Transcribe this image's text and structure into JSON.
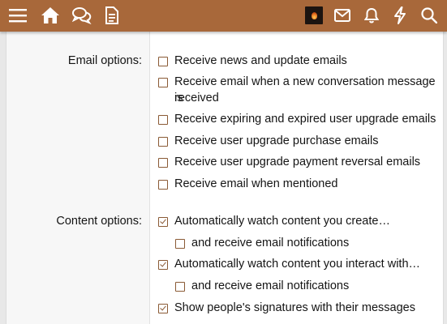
{
  "topbar": {
    "icons": [
      "menu-icon",
      "home-icon",
      "conversations-icon",
      "document-icon",
      "mail-icon",
      "bell-icon",
      "lightning-icon",
      "search-icon"
    ],
    "colors": {
      "bar": "#a8683a",
      "icon": "#ffffff"
    }
  },
  "email_options": {
    "label": "Email options:",
    "items": [
      {
        "text": "Receive news and update emails",
        "checked": false
      },
      {
        "text": "Receive email when a new conversation message is",
        "text2": "received",
        "checked": false
      },
      {
        "text": "Receive expiring and expired user upgrade emails",
        "checked": false
      },
      {
        "text": "Receive user upgrade purchase emails",
        "checked": false
      },
      {
        "text": "Receive user upgrade payment reversal emails",
        "checked": false
      },
      {
        "text": "Receive email when mentioned",
        "checked": false
      }
    ]
  },
  "content_options": {
    "label": "Content options:",
    "items": [
      {
        "text": "Automatically watch content you create…",
        "checked": true
      },
      {
        "text": "and receive email notifications",
        "checked": false
      },
      {
        "text": "Automatically watch content you interact with…",
        "checked": true
      },
      {
        "text": "and receive email notifications",
        "checked": false
      },
      {
        "text": "Show people's signatures with their messages",
        "checked": true
      }
    ]
  }
}
